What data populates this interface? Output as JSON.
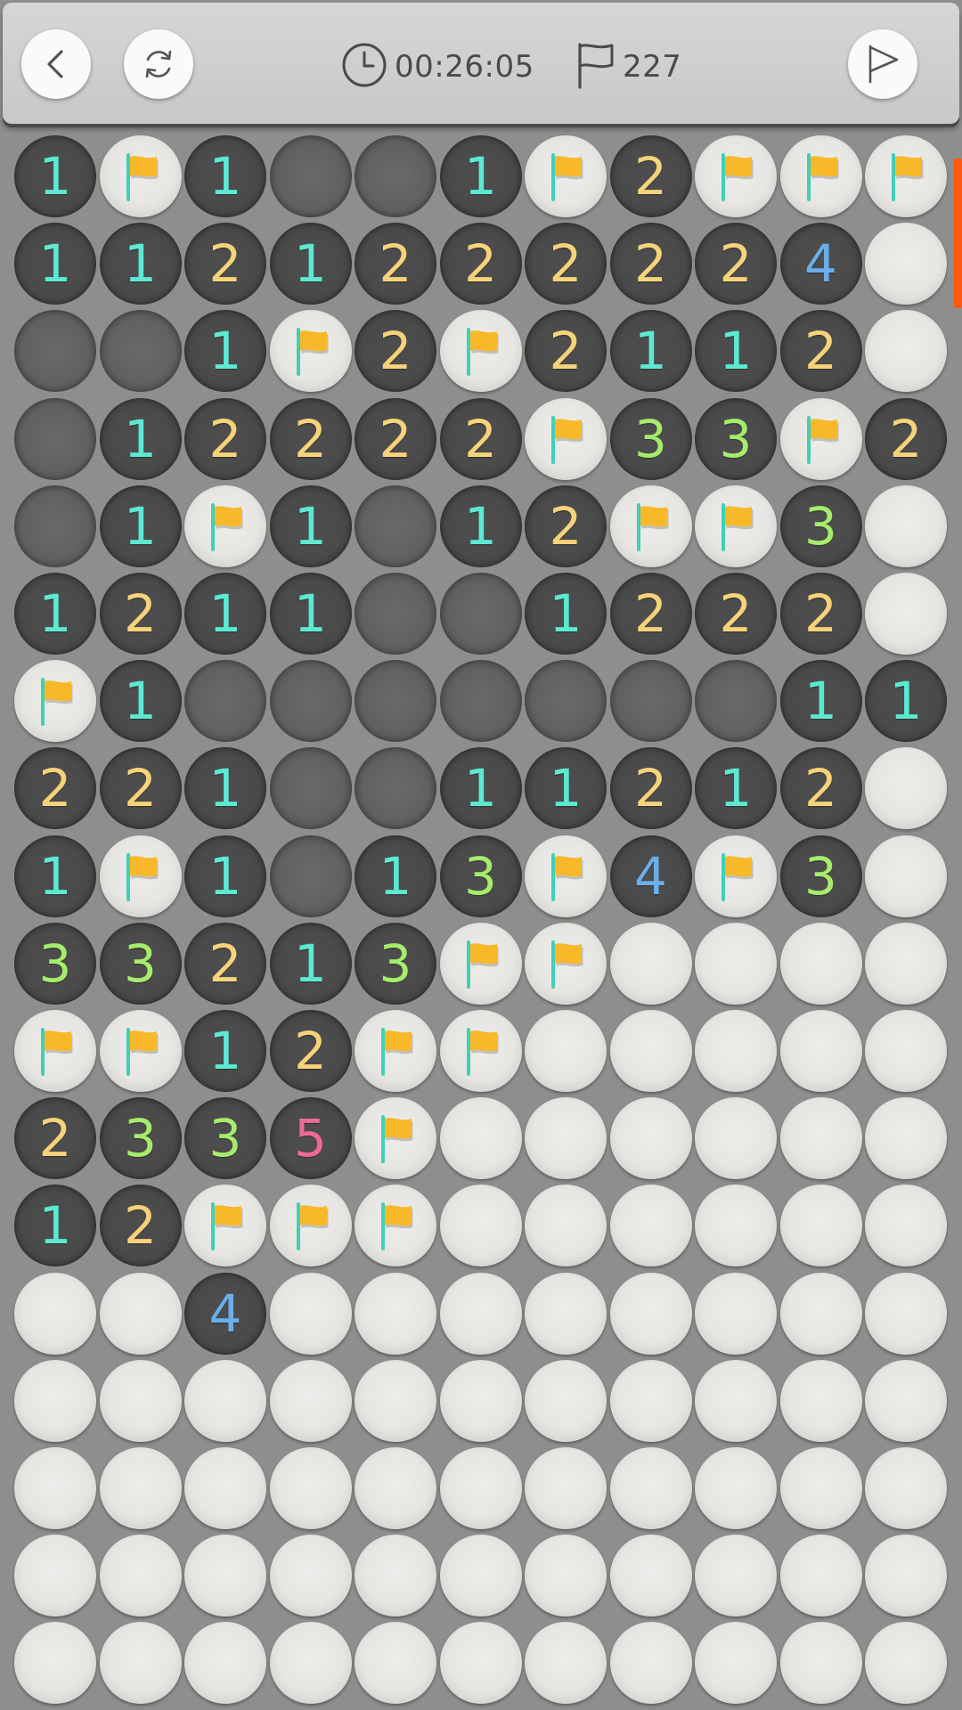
{
  "header": {
    "back_icon": "chevron-left-icon",
    "restart_icon": "refresh-icon",
    "timer_icon": "clock-icon",
    "timer": "00:26:05",
    "flag_icon": "flag-outline-icon",
    "flags_count": "227",
    "flag_mode_icon": "flag-outline-icon"
  },
  "colors": {
    "1": "#5de8d2",
    "2": "#f6d37a",
    "3": "#a6ec6c",
    "4": "#6aaeea",
    "5": "#ee6a96",
    "flag": "#f7b92a",
    "flag_pole": "#3fd0b8",
    "scroll_indicator": "#ff5a14"
  },
  "board": {
    "columns": 11,
    "legend": "H = unrevealed, F = flagged, 0 = revealed empty, 1-5 = adjacent mine count",
    "rows": [
      [
        "1",
        "F",
        "1",
        "0",
        "0",
        "1",
        "F",
        "2",
        "F",
        "F",
        "F"
      ],
      [
        "1",
        "1",
        "2",
        "1",
        "2",
        "2",
        "2",
        "2",
        "2",
        "4",
        "H"
      ],
      [
        "0",
        "0",
        "1",
        "F",
        "2",
        "F",
        "2",
        "1",
        "1",
        "2",
        "H"
      ],
      [
        "0",
        "1",
        "2",
        "2",
        "2",
        "2",
        "F",
        "3",
        "3",
        "F",
        "2"
      ],
      [
        "0",
        "1",
        "F",
        "1",
        "0",
        "1",
        "2",
        "F",
        "F",
        "3",
        "H"
      ],
      [
        "1",
        "2",
        "1",
        "1",
        "0",
        "0",
        "1",
        "2",
        "2",
        "2",
        "H"
      ],
      [
        "F",
        "1",
        "0",
        "0",
        "0",
        "0",
        "0",
        "0",
        "0",
        "1",
        "1"
      ],
      [
        "2",
        "2",
        "1",
        "0",
        "0",
        "1",
        "1",
        "2",
        "1",
        "2",
        "H"
      ],
      [
        "1",
        "F",
        "1",
        "0",
        "1",
        "3",
        "F",
        "4",
        "F",
        "3",
        "H"
      ],
      [
        "3",
        "3",
        "2",
        "1",
        "3",
        "F",
        "F",
        "H",
        "H",
        "H",
        "H"
      ],
      [
        "F",
        "F",
        "1",
        "2",
        "F",
        "F",
        "H",
        "H",
        "H",
        "H",
        "H"
      ],
      [
        "2",
        "3",
        "3",
        "5",
        "F",
        "H",
        "H",
        "H",
        "H",
        "H",
        "H"
      ],
      [
        "1",
        "2",
        "F",
        "F",
        "F",
        "H",
        "H",
        "H",
        "H",
        "H",
        "H"
      ],
      [
        "H",
        "H",
        "4",
        "H",
        "H",
        "H",
        "H",
        "H",
        "H",
        "H",
        "H"
      ],
      [
        "H",
        "H",
        "H",
        "H",
        "H",
        "H",
        "H",
        "H",
        "H",
        "H",
        "H"
      ],
      [
        "H",
        "H",
        "H",
        "H",
        "H",
        "H",
        "H",
        "H",
        "H",
        "H",
        "H"
      ],
      [
        "H",
        "H",
        "H",
        "H",
        "H",
        "H",
        "H",
        "H",
        "H",
        "H",
        "H"
      ],
      [
        "H",
        "H",
        "H",
        "H",
        "H",
        "H",
        "H",
        "H",
        "H",
        "H",
        "H"
      ]
    ]
  }
}
